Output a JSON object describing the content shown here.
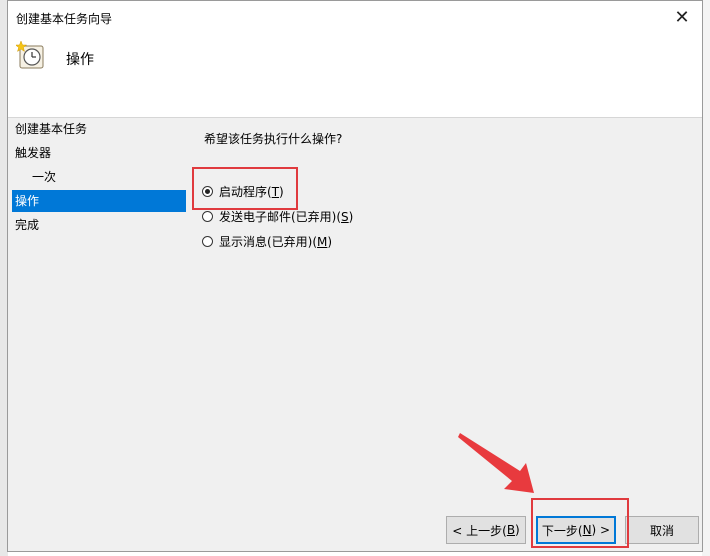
{
  "window": {
    "title": "创建基本任务向导",
    "close_glyph": "✕"
  },
  "header": {
    "title": "操作",
    "icon": "clock-icon"
  },
  "nav": {
    "items": [
      {
        "label": "创建基本任务"
      },
      {
        "label": "触发器"
      },
      {
        "label": "一次"
      },
      {
        "label": "操作"
      },
      {
        "label": "完成"
      }
    ],
    "active_index": 3
  },
  "content": {
    "question": "希望该任务执行什么操作?",
    "options": [
      {
        "label": "启动程序(",
        "mnemonic": "T",
        "suffix": ")",
        "checked": true
      },
      {
        "label": "发送电子邮件(已弃用)(",
        "mnemonic": "S",
        "suffix": ")",
        "checked": false
      },
      {
        "label": "显示消息(已弃用)(",
        "mnemonic": "M",
        "suffix": ")",
        "checked": false
      }
    ]
  },
  "footer": {
    "back_label": "< 上一步(",
    "back_mnemonic": "B",
    "back_suffix": ")",
    "next_label": "下一步(",
    "next_mnemonic": "N",
    "next_suffix": ") >",
    "cancel_label": "取消"
  },
  "colors": {
    "accent": "#0078d7",
    "highlight": "#e03a3e"
  }
}
